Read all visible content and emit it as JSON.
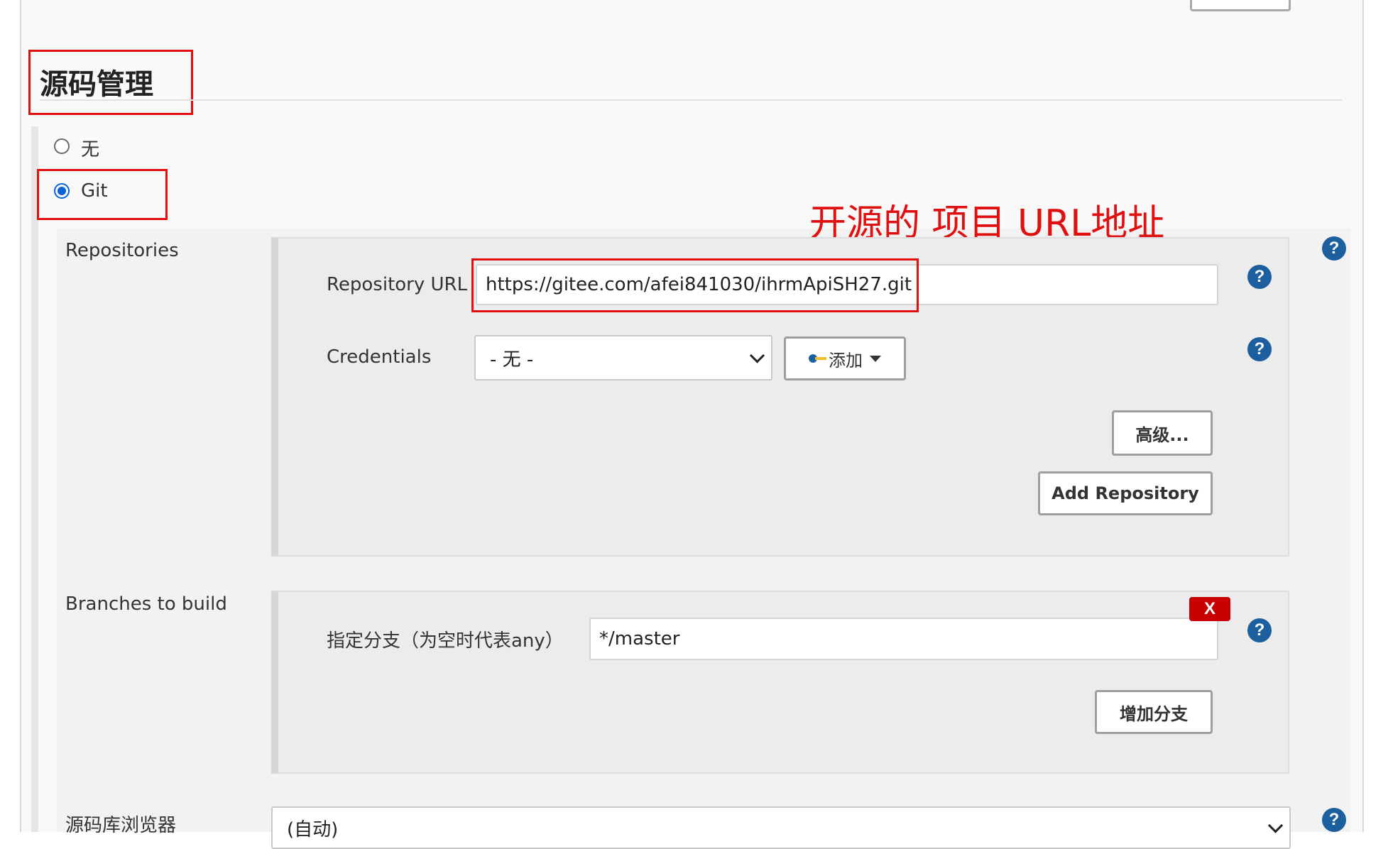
{
  "section": {
    "title": "源码管理"
  },
  "scm_options": [
    {
      "label": "无",
      "checked": false
    },
    {
      "label": "Git",
      "checked": true
    }
  ],
  "annotation": "开源的  项目 URL地址",
  "repositories": {
    "label": "Repositories",
    "url_label": "Repository URL",
    "url_value": "https://gitee.com/afei841030/ihrmApiSH27.git",
    "credentials_label": "Credentials",
    "credentials_value": "- 无 -",
    "add_label": "添加",
    "advanced_label": "高级...",
    "add_repo_label": "Add Repository"
  },
  "branches": {
    "label": "Branches to build",
    "spec_label": "指定分支（为空时代表any）",
    "spec_value": "*/master",
    "delete_label": "X",
    "add_branch_label": "增加分支"
  },
  "browser": {
    "label": "源码库浏览器",
    "value": "(自动)"
  },
  "help_glyph": "?",
  "colors": {
    "annotation_red": "#e01010",
    "help_blue": "#1c5f9e",
    "radio_blue": "#0a63d6",
    "delete_red": "#c80000"
  }
}
